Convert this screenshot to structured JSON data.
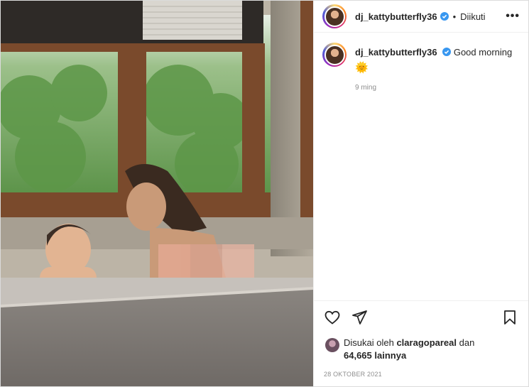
{
  "post": {
    "username": "dj_kattybutterfly36",
    "dot": "•",
    "follow_status": "Diikuti",
    "more_label": "•••",
    "caption_username": "dj_kattybutterfly36",
    "caption_text": "Good morning",
    "caption_emoji": "🌞",
    "caption_age": "9 ming",
    "likes_prefix": "Disukai oleh",
    "liked_by": "claragopareal",
    "likes_joiner": "dan",
    "likes_count": "64,665 lainnya",
    "date": "28 OKTOBER 2021"
  },
  "icons": {
    "verified": "verified-badge-icon",
    "like": "heart-icon",
    "share": "send-icon",
    "save": "bookmark-icon",
    "more": "more-options-icon"
  },
  "colors": {
    "verified": "#3897f0",
    "text": "#262626",
    "muted": "#8e8e8e",
    "border": "#efefef"
  }
}
